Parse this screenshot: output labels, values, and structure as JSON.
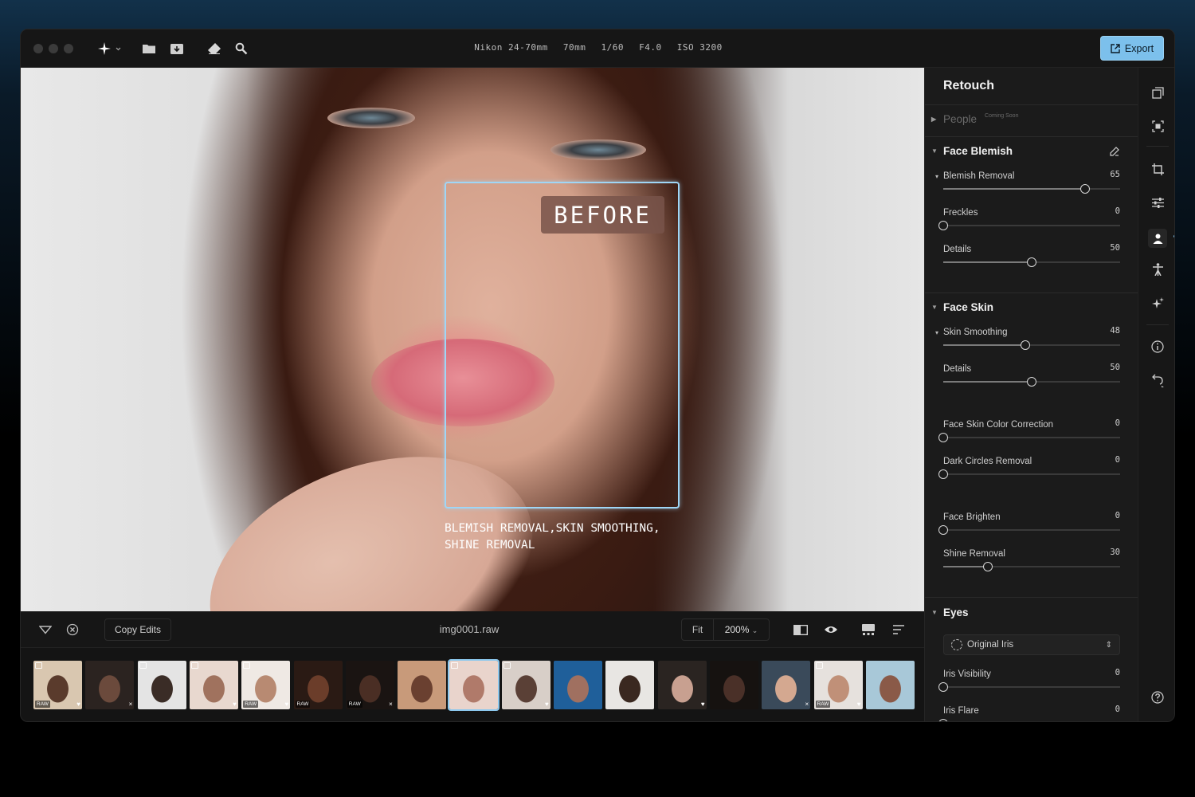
{
  "toolbar": {
    "exif": [
      "Nikon 24-70mm",
      "70mm",
      "1/60",
      "F4.0",
      "ISO 3200"
    ],
    "export_label": "Export",
    "accent": "#7cc0ec"
  },
  "canvas": {
    "before_label": "BEFORE",
    "caption_line1": "BLEMISH REMOVAL,SKIN SMOOTHING,",
    "caption_line2": "SHINE REMOVAL"
  },
  "bottombar": {
    "copy_edits_label": "Copy Edits",
    "filename": "img0001.raw",
    "fit_label": "Fit",
    "zoom_label": "200%"
  },
  "filmstrip": {
    "raw_badge": "RAW",
    "thumbs": [
      {
        "raw": true,
        "edit": true,
        "mark": "♥"
      },
      {
        "raw": false,
        "edit": false,
        "mark": "×"
      },
      {
        "raw": false,
        "edit": true,
        "mark": ""
      },
      {
        "raw": false,
        "edit": true,
        "mark": "♥"
      },
      {
        "raw": true,
        "edit": true,
        "mark": "♥"
      },
      {
        "raw": true,
        "edit": false,
        "mark": ""
      },
      {
        "raw": true,
        "edit": false,
        "mark": "×"
      },
      {
        "raw": false,
        "edit": false,
        "mark": ""
      },
      {
        "raw": false,
        "edit": true,
        "mark": "",
        "selected": true
      },
      {
        "raw": false,
        "edit": true,
        "mark": "♥"
      },
      {
        "raw": false,
        "edit": false,
        "mark": ""
      },
      {
        "raw": false,
        "edit": false,
        "mark": ""
      },
      {
        "raw": false,
        "edit": false,
        "mark": "♥"
      },
      {
        "raw": false,
        "edit": false,
        "mark": ""
      },
      {
        "raw": false,
        "edit": false,
        "mark": "×"
      },
      {
        "raw": true,
        "edit": true,
        "mark": "♥"
      },
      {
        "raw": false,
        "edit": false,
        "mark": ""
      }
    ]
  },
  "panel": {
    "title": "Retouch",
    "people_label": "People",
    "people_badge": "Coming Soon",
    "face_blemish": {
      "title": "Face Blemish",
      "sliders": [
        {
          "label": "Blemish Removal",
          "value": "65",
          "level": 0.8
        },
        {
          "label": "Freckles",
          "value": "0",
          "level": 0.0
        },
        {
          "label": "Details",
          "value": "50",
          "level": 0.5
        }
      ]
    },
    "face_skin": {
      "title": "Face Skin",
      "sliders": [
        {
          "label": "Skin Smoothing",
          "value": "48",
          "level": 0.465
        },
        {
          "label": "Details",
          "value": "50",
          "level": 0.5
        },
        {
          "label": "Face Skin Color Correction",
          "value": "0",
          "level": 0.0
        },
        {
          "label": "Dark Circles Removal",
          "value": "0",
          "level": 0.0
        },
        {
          "label": "Face Brighten",
          "value": "0",
          "level": 0.0
        },
        {
          "label": "Shine Removal",
          "value": "30",
          "level": 0.25
        }
      ]
    },
    "eyes": {
      "title": "Eyes",
      "iris_select": "Original Iris",
      "sliders": [
        {
          "label": "Iris Visibility",
          "value": "0",
          "level": 0.0
        },
        {
          "label": "Iris Flare",
          "value": "0",
          "level": 0.0
        }
      ]
    }
  }
}
